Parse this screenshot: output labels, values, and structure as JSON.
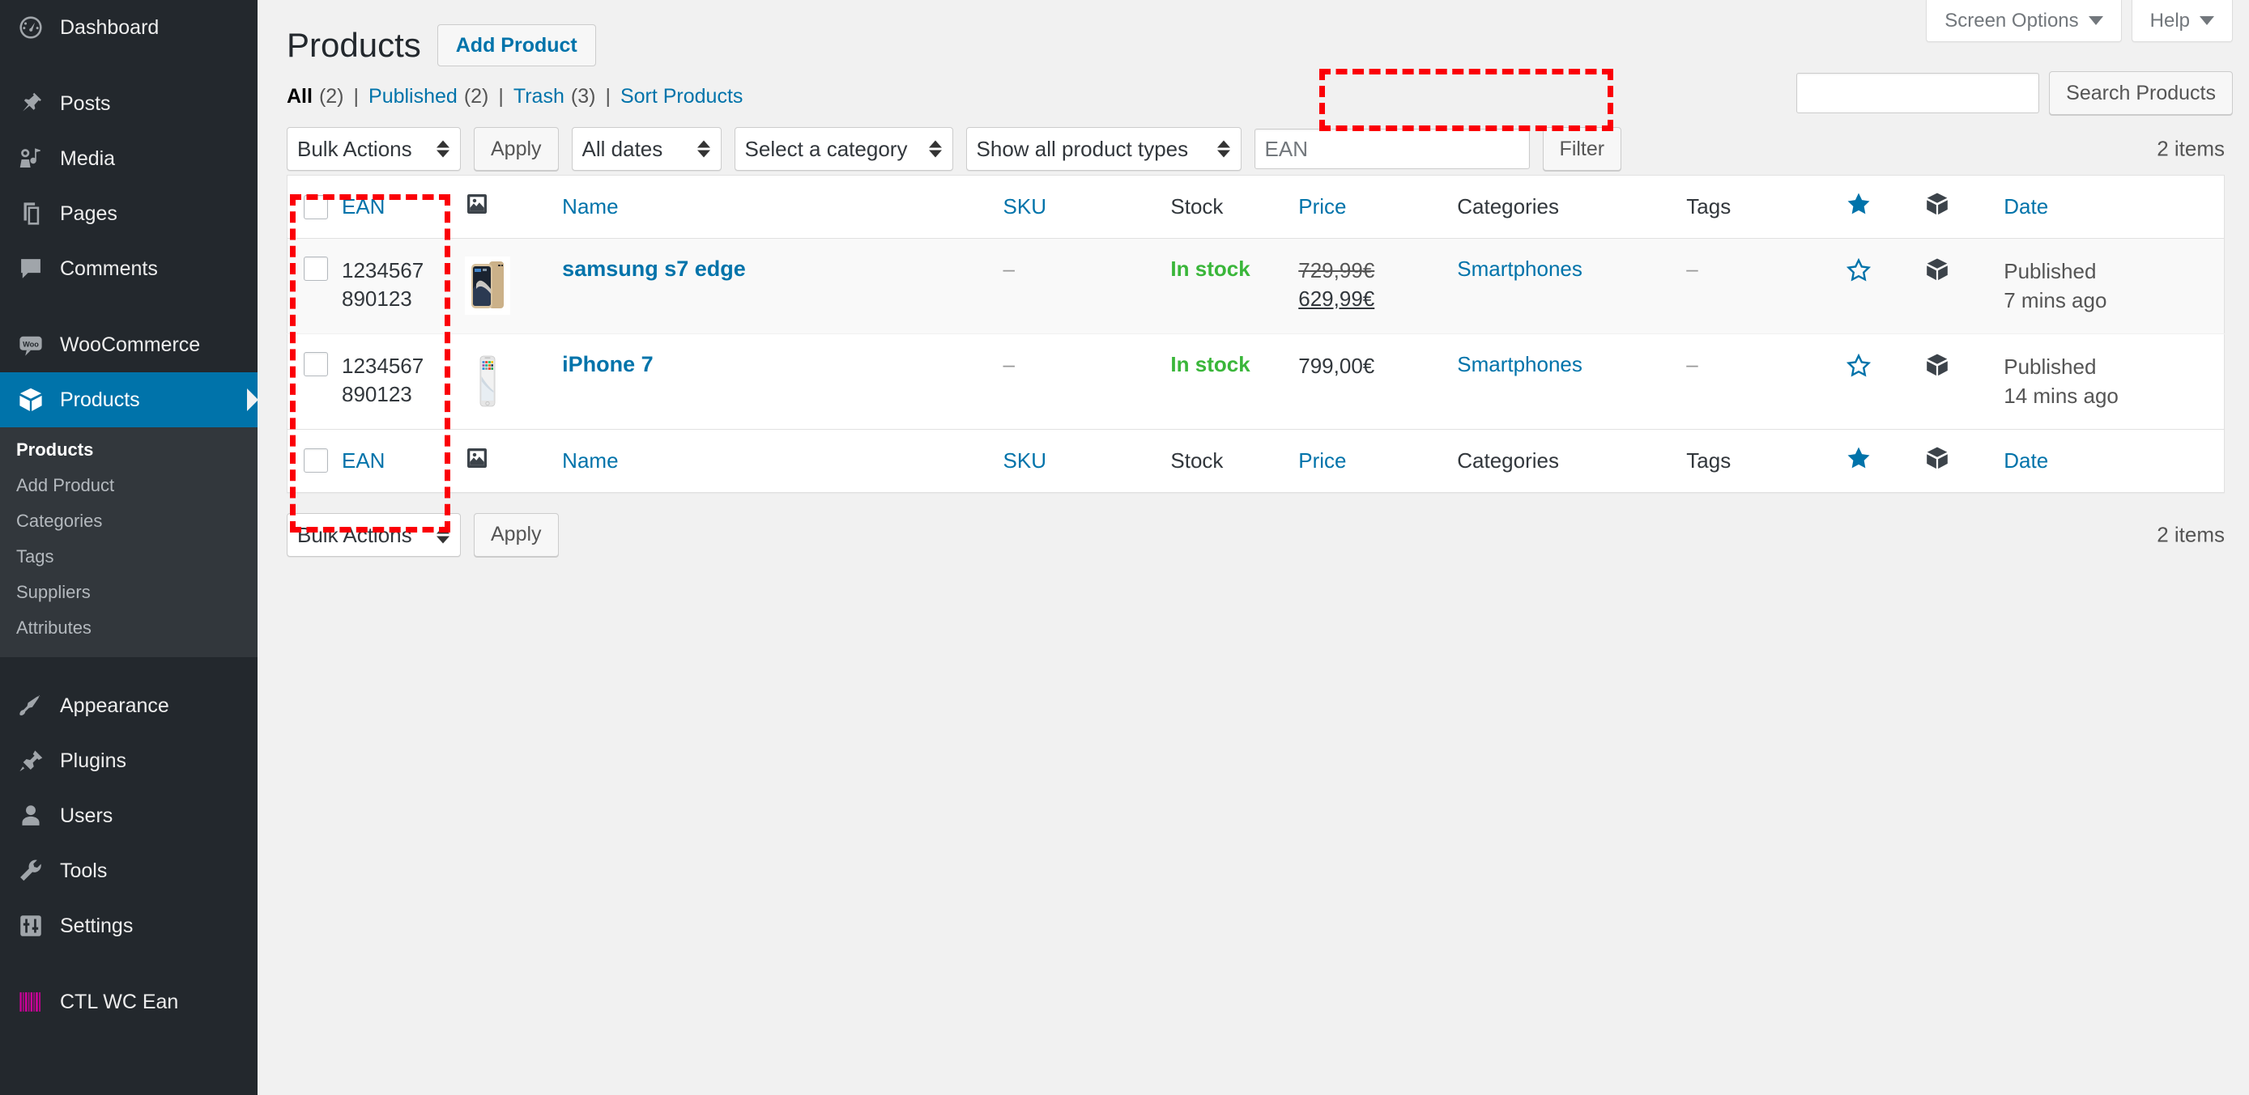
{
  "sidebar": {
    "items": [
      {
        "label": "Dashboard",
        "icon": "dashboard-icon"
      },
      {
        "label": "Posts",
        "icon": "pin-icon"
      },
      {
        "label": "Media",
        "icon": "media-icon"
      },
      {
        "label": "Pages",
        "icon": "pages-icon"
      },
      {
        "label": "Comments",
        "icon": "comments-icon"
      },
      {
        "label": "WooCommerce",
        "icon": "woo-icon"
      },
      {
        "label": "Products",
        "icon": "products-box-icon"
      },
      {
        "label": "Appearance",
        "icon": "brush-icon"
      },
      {
        "label": "Plugins",
        "icon": "plug-icon"
      },
      {
        "label": "Users",
        "icon": "user-icon"
      },
      {
        "label": "Tools",
        "icon": "wrench-icon"
      },
      {
        "label": "Settings",
        "icon": "sliders-icon"
      },
      {
        "label": "CTL WC Ean",
        "icon": "barcode-icon"
      }
    ],
    "submenu": [
      {
        "label": "Products",
        "current": true
      },
      {
        "label": "Add Product",
        "current": false
      },
      {
        "label": "Categories",
        "current": false
      },
      {
        "label": "Tags",
        "current": false
      },
      {
        "label": "Suppliers",
        "current": false
      },
      {
        "label": "Attributes",
        "current": false
      }
    ],
    "active_color": "#0073aa",
    "bg_color": "#23282d",
    "submenu_bg_color": "#32373c",
    "barcode_color": "#cc0099"
  },
  "screen_meta": {
    "screen_options_label": "Screen Options",
    "help_label": "Help"
  },
  "header": {
    "page_title": "Products",
    "add_product_label": "Add Product"
  },
  "views": [
    {
      "label": "All",
      "count": "(2)",
      "current": true
    },
    {
      "label": "Published",
      "count": "(2)",
      "current": false
    },
    {
      "label": "Trash",
      "count": "(3)",
      "current": false
    },
    {
      "label": "Sort Products",
      "count": "",
      "current": false
    }
  ],
  "search": {
    "value": "",
    "button_label": "Search Products"
  },
  "tablenav_top": {
    "bulk_actions": "Bulk Actions",
    "apply_label": "Apply",
    "dates": "All dates",
    "category": "Select a category",
    "product_types": "Show all product types",
    "ean_placeholder": "EAN",
    "ean_value": "",
    "filter_label": "Filter",
    "items_count": "2 items"
  },
  "tablenav_bottom": {
    "bulk_actions": "Bulk Actions",
    "apply_label": "Apply",
    "items_count": "2 items"
  },
  "table": {
    "columns": [
      {
        "key": "cb",
        "label": "",
        "link": false,
        "icon": ""
      },
      {
        "key": "ean",
        "label": "EAN",
        "link": true,
        "icon": ""
      },
      {
        "key": "thumb",
        "label": "",
        "link": false,
        "icon": "image-icon"
      },
      {
        "key": "name",
        "label": "Name",
        "link": true,
        "icon": ""
      },
      {
        "key": "sku",
        "label": "SKU",
        "link": true,
        "icon": ""
      },
      {
        "key": "stock",
        "label": "Stock",
        "link": false,
        "icon": ""
      },
      {
        "key": "price",
        "label": "Price",
        "link": true,
        "icon": ""
      },
      {
        "key": "cat",
        "label": "Categories",
        "link": false,
        "icon": ""
      },
      {
        "key": "tags",
        "label": "Tags",
        "link": false,
        "icon": ""
      },
      {
        "key": "feat",
        "label": "",
        "link": false,
        "icon": "star-filled-icon"
      },
      {
        "key": "type",
        "label": "",
        "link": false,
        "icon": "box-icon"
      },
      {
        "key": "date",
        "label": "Date",
        "link": true,
        "icon": ""
      }
    ],
    "rows": [
      {
        "ean_line1": "1234567",
        "ean_line2": "890123",
        "thumb": "samsung-s7-edge-thumbnail",
        "name": "samsung s7 edge",
        "sku": "–",
        "stock": "In stock",
        "price_regular": "729,99€",
        "price_sale": "629,99€",
        "categories": "Smartphones",
        "tags": "–",
        "featured": "star-outline-icon",
        "type": "box-icon",
        "date_status": "Published",
        "date_when": "7 mins ago"
      },
      {
        "ean_line1": "1234567",
        "ean_line2": "890123",
        "thumb": "iphone-7-thumbnail",
        "name": "iPhone 7",
        "sku": "–",
        "stock": "In stock",
        "price_regular": "",
        "price_sale": "799,00€",
        "categories": "Smartphones",
        "tags": "–",
        "featured": "star-outline-icon",
        "type": "box-icon",
        "date_status": "Published",
        "date_when": "14 mins ago"
      }
    ]
  },
  "annotations": {
    "color": "#fb0007",
    "ean_column_highlight": "EAN column highlighted",
    "ean_filter_highlight": "EAN filter field highlighted"
  }
}
